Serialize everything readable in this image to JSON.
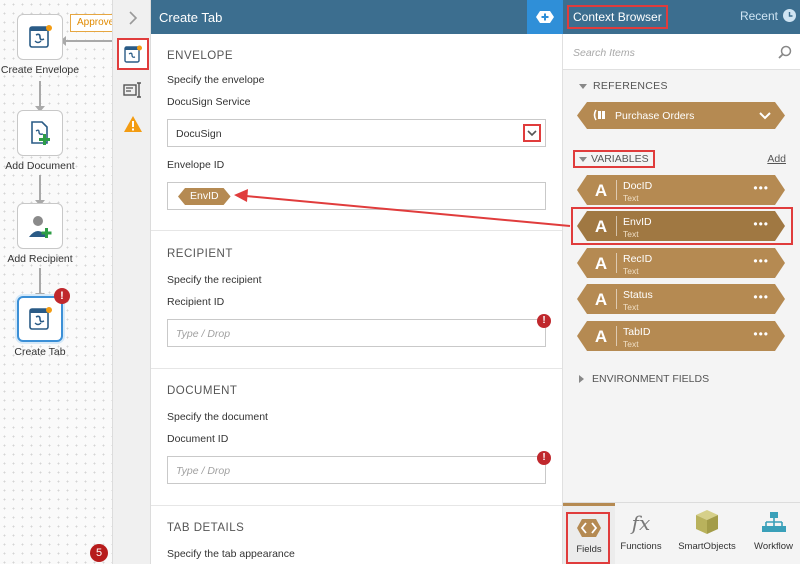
{
  "workflow": {
    "approved_tag": "Approve",
    "steps": [
      {
        "label": "Create Envelope",
        "icon": "docusign-icon"
      },
      {
        "label": "Add Document",
        "icon": "add-document-icon"
      },
      {
        "label": "Add Recipient",
        "icon": "add-recipient-icon"
      },
      {
        "label": "Create Tab",
        "icon": "docusign-icon"
      }
    ],
    "step_error": "!",
    "error_count": "5"
  },
  "toolbar": {
    "items": [
      "properties-icon",
      "input-config-icon",
      "warning-icon"
    ]
  },
  "panel": {
    "title": "Create Tab",
    "envelope": {
      "section": "ENVELOPE",
      "instruction": "Specify the envelope",
      "service_label": "DocuSign Service",
      "service_value": "DocuSign",
      "envid_label": "Envelope ID",
      "envid_token": "EnvID"
    },
    "recipient": {
      "section": "RECIPIENT",
      "instruction": "Specify the recipient",
      "field_label": "Recipient ID",
      "placeholder": "Type / Drop"
    },
    "document": {
      "section": "DOCUMENT",
      "instruction": "Specify the document",
      "field_label": "Document ID",
      "placeholder": "Type / Drop"
    },
    "tab_details": {
      "section": "TAB DETAILS",
      "instruction": "Specify the tab appearance"
    },
    "error_mark": "!"
  },
  "context": {
    "title": "Context Browser",
    "recent": "Recent",
    "search_placeholder": "Search Items",
    "references_header": "REFERENCES",
    "reference_item": "Purchase Orders",
    "variables_header": "VARIABLES",
    "add_label": "Add",
    "variables": [
      {
        "name": "DocID",
        "type": "Text",
        "glyph": "A"
      },
      {
        "name": "EnvID",
        "type": "Text",
        "glyph": "A"
      },
      {
        "name": "RecID",
        "type": "Text",
        "glyph": "A"
      },
      {
        "name": "Status",
        "type": "Text",
        "glyph": "A"
      },
      {
        "name": "TabID",
        "type": "Text",
        "glyph": "A"
      }
    ],
    "more_label": "•••",
    "environment_header": "ENVIRONMENT FIELDS",
    "footer_tabs": [
      {
        "label": "Fields",
        "icon": "fields-icon"
      },
      {
        "label": "Functions",
        "icon": "functions-icon",
        "glyph": "fx"
      },
      {
        "label": "SmartObjects",
        "icon": "smartobjects-icon"
      },
      {
        "label": "Workflow",
        "icon": "workflow-icon"
      }
    ]
  },
  "colors": {
    "header": "#3c6e8f",
    "token": "#b58a52",
    "highlight": "#e03c3c",
    "add_button": "#2f8fd8"
  }
}
